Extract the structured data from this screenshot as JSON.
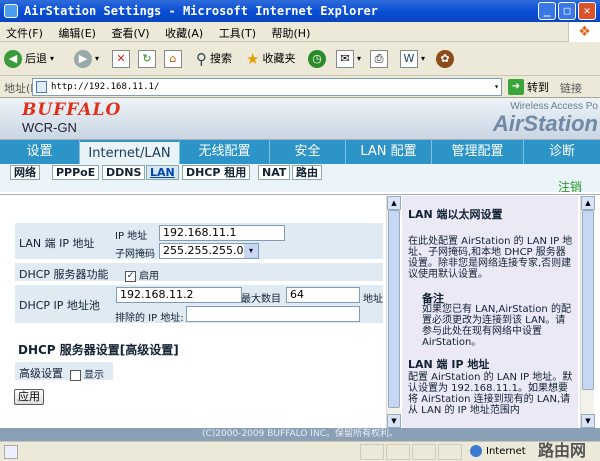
{
  "window": {
    "title": "AirStation Settings - Microsoft Internet Explorer"
  },
  "menu": [
    "文件(F)",
    "编辑(E)",
    "查看(V)",
    "收藏(A)",
    "工具(T)",
    "帮助(H)"
  ],
  "toolbar": {
    "back": "后退",
    "search": "搜索",
    "favorites": "收藏夹"
  },
  "address": {
    "label": "地址(D)",
    "url": "http://192.168.11.1/",
    "go": "转到",
    "links": "链接"
  },
  "header": {
    "logo": "BUFFALO",
    "model": "WCR-GN",
    "brand_sub": "Wireless Access Po",
    "brand": "AirStation"
  },
  "tabs": [
    "设置",
    "Internet/LAN",
    "无线配置",
    "安全",
    "LAN 配置",
    "管理配置",
    "诊断"
  ],
  "subtabs": [
    "网络",
    "PPPoE",
    "DDNS",
    "LAN",
    "DHCP 租用",
    "NAT",
    "路由"
  ],
  "logout": "注销",
  "form": {
    "lan_ip_label": "LAN 端 IP 地址",
    "ip_label": "IP 地址",
    "ip_value": "192.168.11.1",
    "mask_label": "子网掩码",
    "mask_value": "255.255.255.0",
    "dhcp_func_label": "DHCP 服务器功能",
    "dhcp_enable": "启用",
    "pool_label": "DHCP IP 地址池",
    "pool_start": "192.168.11.2",
    "pool_max_label": "最大数目",
    "pool_max": "64",
    "pool_unit": "地址",
    "exclude_label": "排除的 IP 地址:",
    "adv_title": "DHCP 服务器设置[高级设置]",
    "adv_label": "高级设置",
    "adv_show": "显示",
    "apply": "应用"
  },
  "help": {
    "h1": "LAN 端以太网设置",
    "p1": "在此处配置 AirStation 的 LAN IP 地址、子网掩码,和本地 DHCP 服务器设置。除非您是网络连接专家,否则建议使用默认设置。",
    "note_title": "备注",
    "note": "如果您已有 LAN,AirStation 的配置必须更改为连接到该 LAN。请参与此处在现有网络中设置 AirStation。",
    "h2": "LAN 端 IP 地址",
    "p2": "配置 AirStation 的 LAN IP 地址。默认设置为 192.168.11.1。如果想要将 AirStation 连接到现有的 LAN,请从 LAN 的 IP 地址范围内"
  },
  "footer": "(C)2000-2009 BUFFALO INC。保留所有权利。",
  "status": {
    "zone": "Internet"
  },
  "watermark": "路由网"
}
